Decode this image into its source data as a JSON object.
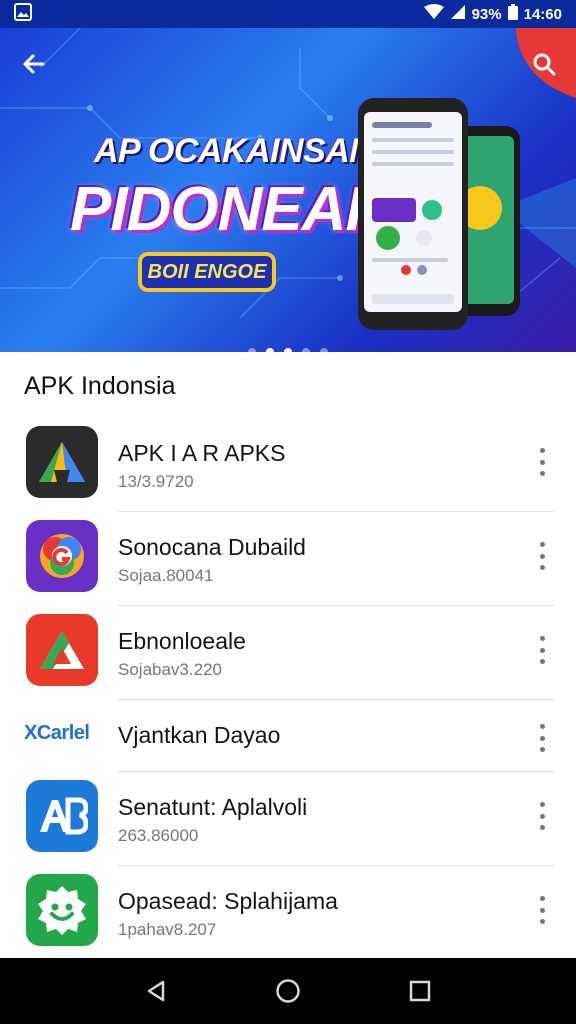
{
  "status_bar": {
    "battery": "93%",
    "time": "14:60"
  },
  "banner": {
    "headline": "AP OCAKAINSAN",
    "title": "PIDONEAIL",
    "badge": "BOII ENGOE",
    "page_count": 5,
    "active_page": 2
  },
  "section": {
    "title": "APK Indonsia"
  },
  "apps": [
    {
      "name": "APK I A R APKS",
      "meta": "13/3.9720",
      "icon": "triangle-logo-icon",
      "color": "#2b2b2b"
    },
    {
      "name": "Sonocana Dubaild",
      "meta": "Sojaa.80041",
      "icon": "g-flower-logo-icon",
      "color": "#6a2fc4"
    },
    {
      "name": "Ebnonloeale",
      "meta": "Sojabav3.220",
      "icon": "red-triangle-logo-icon",
      "color": "#e8392a"
    },
    {
      "name": "Vjantkan Dayao",
      "meta": "",
      "icon": "xcarlel-logo",
      "logo_text": "XCarlel"
    },
    {
      "name": "Senatunt: Aplalvoli",
      "meta": "263.86000",
      "icon": "ab-logo-icon",
      "color": "#1e7ad8"
    },
    {
      "name": "Opasead: Splahijama",
      "meta": "1pahav8.207",
      "icon": "smiley-logo-icon",
      "color": "#22a84a"
    }
  ],
  "colors": {
    "status_bar": "#0a2a9e",
    "accent_red": "#e53935"
  }
}
